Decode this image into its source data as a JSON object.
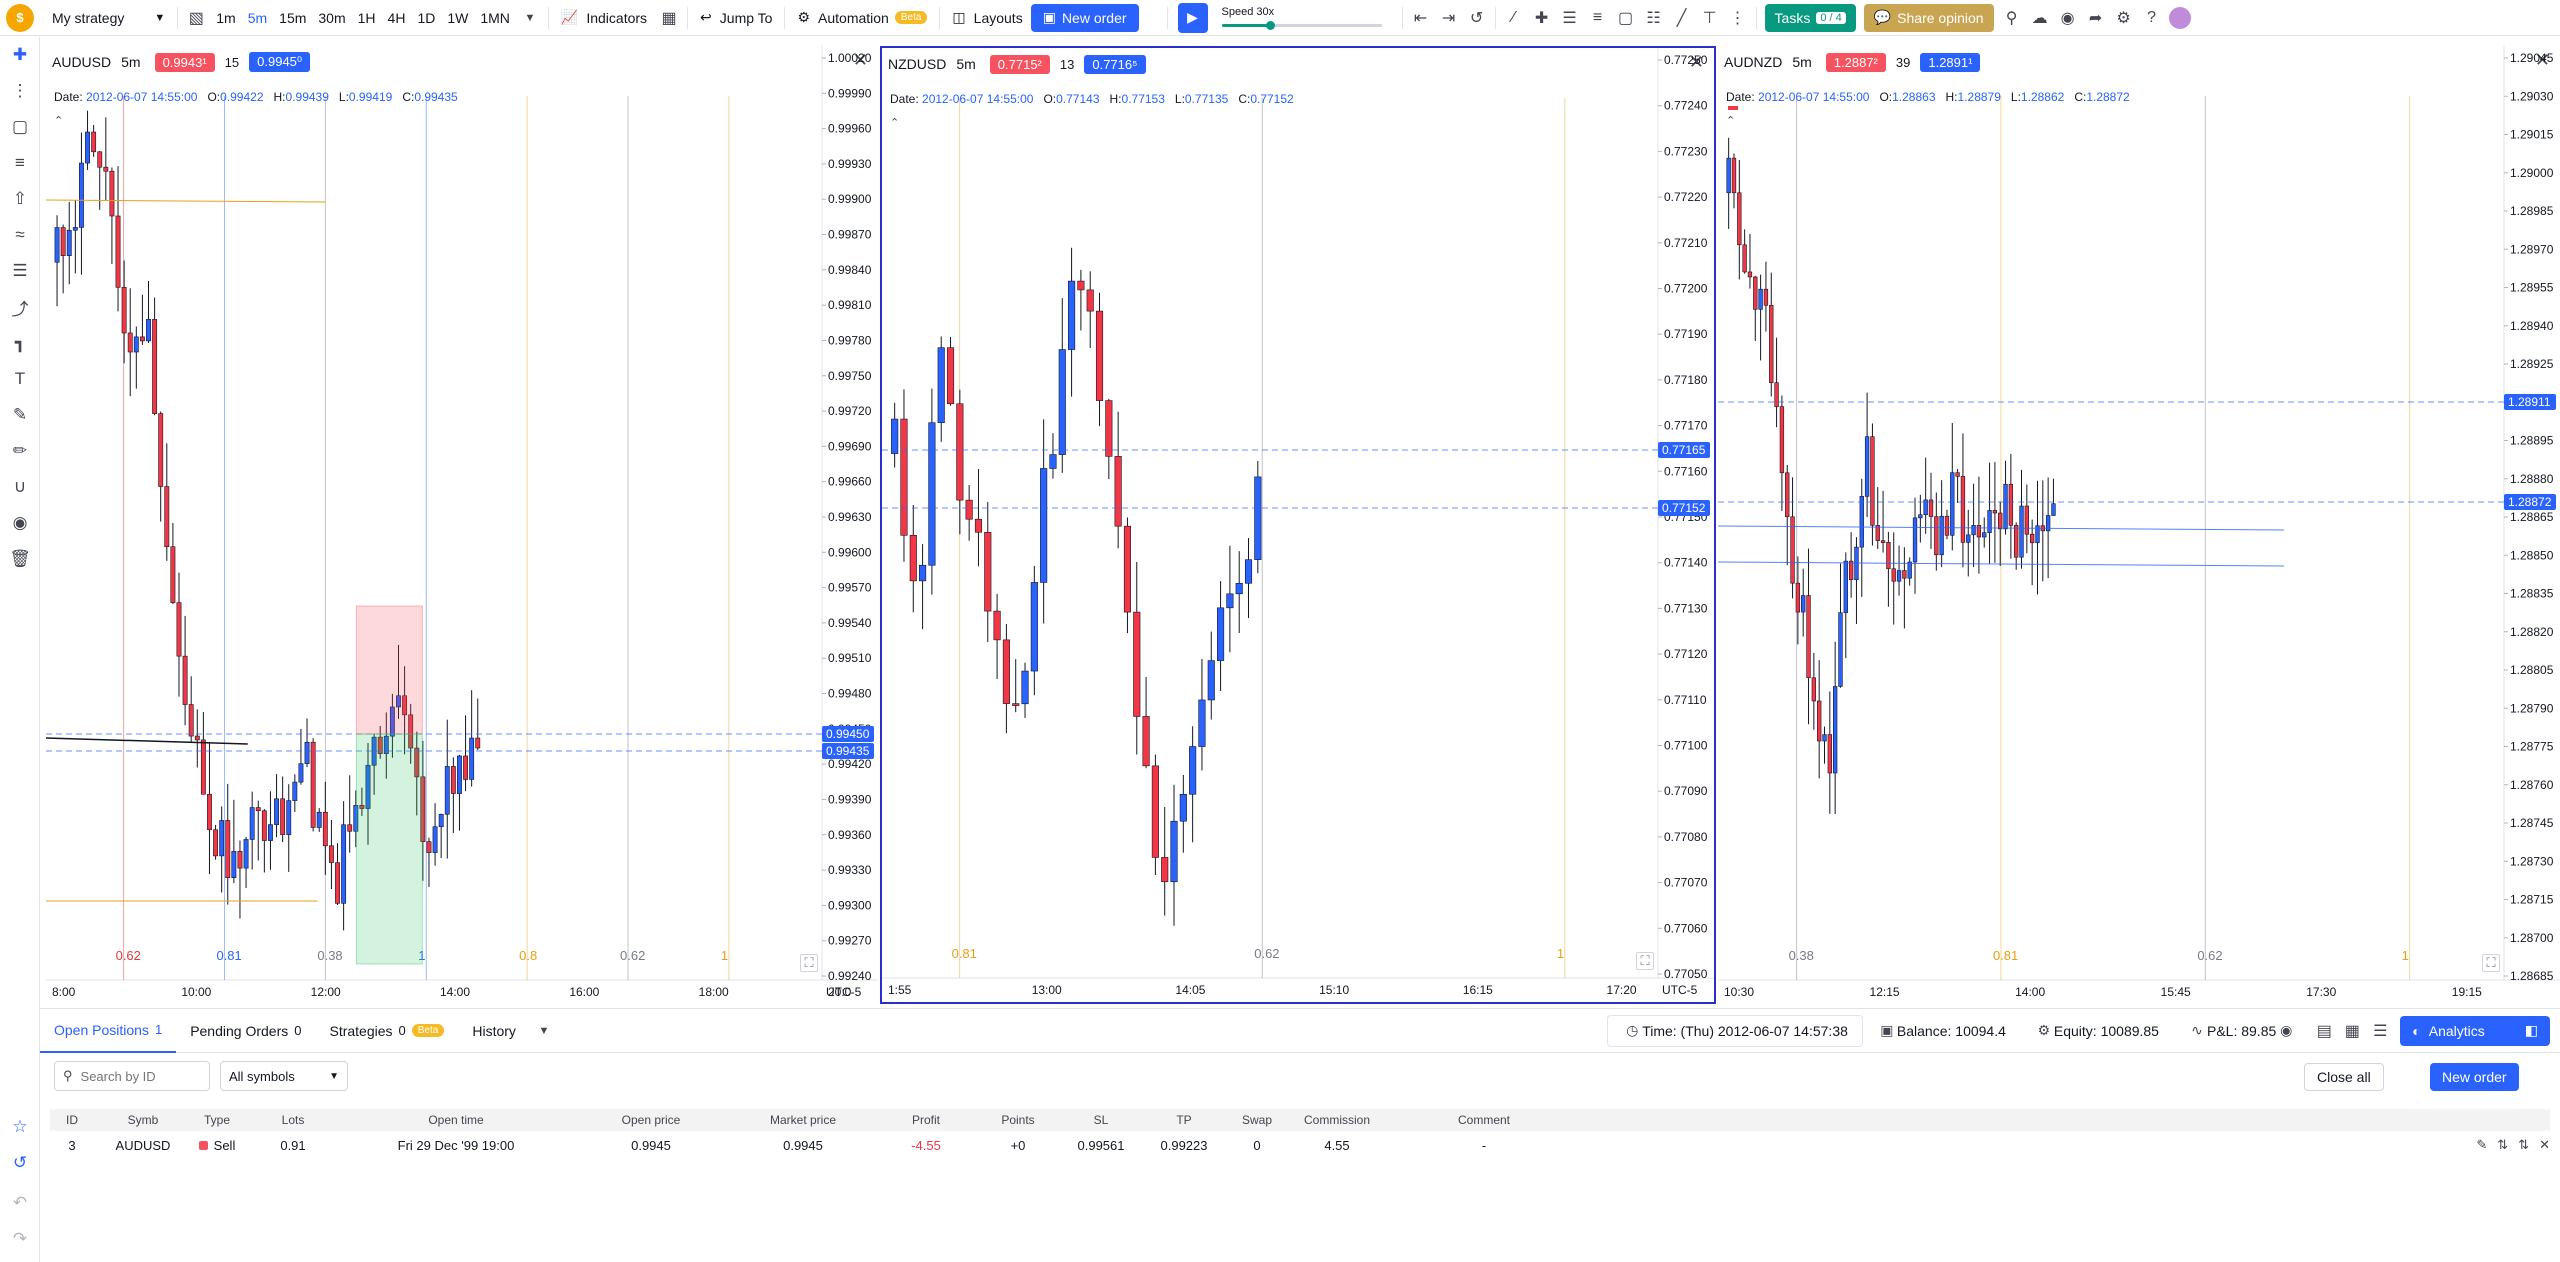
{
  "toolbar": {
    "strategy": "My strategy",
    "timeframes": [
      "1m",
      "5m",
      "15m",
      "30m",
      "1H",
      "4H",
      "1D",
      "1W",
      "1MN"
    ],
    "active_tf": "5m",
    "indicators": "Indicators",
    "jump_to": "Jump To",
    "automation": "Automation",
    "beta": "Beta",
    "layouts": "Layouts",
    "new_order": "New order",
    "speed": "Speed 30x",
    "speed_level": 0.3,
    "tasks": "Tasks",
    "tasks_count": "0 / 4",
    "share": "Share opinion"
  },
  "panes": [
    {
      "symbol": "AUDUSD",
      "res": "5m",
      "sell": "0.9943¹",
      "spread": "15",
      "buy": "0.9945⁰",
      "date": "2012-06-07 14:55:00",
      "o": "0.99422",
      "h": "0.99439",
      "l": "0.99419",
      "c": "0.99435",
      "ylabels": [
        "1.00020",
        "0.99990",
        "0.99960",
        "0.99930",
        "0.99900",
        "0.99870",
        "0.99840",
        "0.99810",
        "0.99780",
        "0.99750",
        "0.99720",
        "0.99690",
        "0.99660",
        "0.99630",
        "0.99600",
        "0.99570",
        "0.99540",
        "0.99510",
        "0.99480",
        "0.99450",
        "0.99420",
        "0.99390",
        "0.99360",
        "0.99330",
        "0.99300",
        "0.99270",
        "0.99240"
      ],
      "xlabels": [
        "8:00",
        "10:00",
        "12:00",
        "14:00",
        "16:00",
        "18:00",
        "20:0"
      ],
      "tags": [
        "0.99450",
        "0.99435"
      ],
      "fib": [
        {
          "t": "0.62",
          "c": "#e03a3a"
        },
        {
          "t": "0.81",
          "c": "#2962ff"
        },
        {
          "t": "0.38",
          "c": "#787b86"
        },
        {
          "t": "1",
          "c": "#2962ff"
        },
        {
          "t": "0.8",
          "c": "#e5a117"
        },
        {
          "t": "0.62",
          "c": "#787b86"
        },
        {
          "t": "1",
          "c": "#e5a117"
        }
      ],
      "tz": "UTC-5"
    },
    {
      "symbol": "NZDUSD",
      "res": "5m",
      "sell": "0.7715²",
      "spread": "13",
      "buy": "0.7716⁵",
      "date": "2012-06-07 14:55:00",
      "o": "0.77143",
      "h": "0.77153",
      "l": "0.77135",
      "c": "0.77152",
      "ylabels": [
        "0.77250",
        "0.77240",
        "0.77230",
        "0.77220",
        "0.77210",
        "0.77200",
        "0.77190",
        "0.77180",
        "0.77170",
        "0.77160",
        "0.77150",
        "0.77140",
        "0.77130",
        "0.77120",
        "0.77110",
        "0.77100",
        "0.77090",
        "0.77080",
        "0.77070",
        "0.77060",
        "0.77050"
      ],
      "xlabels": [
        "1:55",
        "13:00",
        "14:05",
        "15:10",
        "16:15",
        "17:20"
      ],
      "tags": [
        "0.77165",
        "0.77152"
      ],
      "fib": [
        {
          "t": "0.81",
          "c": "#e5a117"
        },
        {
          "t": "0.62",
          "c": "#787b86"
        },
        {
          "t": "1",
          "c": "#e5a117"
        }
      ],
      "tz": "UTC-5"
    },
    {
      "symbol": "AUDNZD",
      "res": "5m",
      "sell": "1.2887²",
      "spread": "39",
      "buy": "1.2891¹",
      "date": "2012-06-07 14:55:00",
      "o": "1.28863",
      "h": "1.28879",
      "l": "1.28862",
      "c": "1.28872",
      "ylabels": [
        "1.29045",
        "1.29030",
        "1.29015",
        "1.29000",
        "1.28985",
        "1.28970",
        "1.28955",
        "1.28940",
        "1.28925",
        "1.28910",
        "1.28895",
        "1.28880",
        "1.28865",
        "1.28850",
        "1.28835",
        "1.28820",
        "1.28805",
        "1.28790",
        "1.28775",
        "1.28760",
        "1.28745",
        "1.28730",
        "1.28715",
        "1.28700",
        "1.28685"
      ],
      "xlabels": [
        "10:30",
        "12:15",
        "14:00",
        "15:45",
        "17:30",
        "19:15"
      ],
      "tags": [
        "1.28911",
        "1.28872"
      ],
      "fib": [
        {
          "t": "0.38",
          "c": "#787b86"
        },
        {
          "t": "0.81",
          "c": "#e5a117"
        },
        {
          "t": "0.62",
          "c": "#787b86"
        },
        {
          "t": "1",
          "c": "#e5a117"
        }
      ],
      "tz": ""
    }
  ],
  "bottom": {
    "tabs": [
      {
        "label": "Open Positions",
        "count": "1"
      },
      {
        "label": "Pending Orders",
        "count": "0"
      },
      {
        "label": "Strategies",
        "count": "0"
      },
      {
        "label": "History",
        "count": ""
      }
    ],
    "time": "Time: (Thu) 2012-06-07 14:57:38",
    "balance": "Balance: 10094.4",
    "equity": "Equity: 10089.85",
    "pnl": "P&L: 89.85",
    "analytics": "Analytics",
    "search_placeholder": "Search by ID",
    "symbols_select": "All symbols",
    "close_all": "Close all",
    "new_order": "New order",
    "columns": [
      "ID",
      "Symb",
      "Type",
      "Lots",
      "Open time",
      "Open price",
      "Market price",
      "Profit",
      "Points",
      "SL",
      "TP",
      "Swap",
      "Commission",
      "Comment"
    ],
    "rows": [
      {
        "id": "3",
        "symb": "AUDUSD",
        "type": "Sell",
        "lots": "0.91",
        "open_time": "Fri 29 Dec '99 19:00",
        "open_price": "0.9945",
        "market_price": "0.9945",
        "profit": "-4.55",
        "points": "+0",
        "sl": "0.99561",
        "tp": "0.99223",
        "swap": "0",
        "commission": "4.55",
        "comment": "-"
      }
    ]
  }
}
